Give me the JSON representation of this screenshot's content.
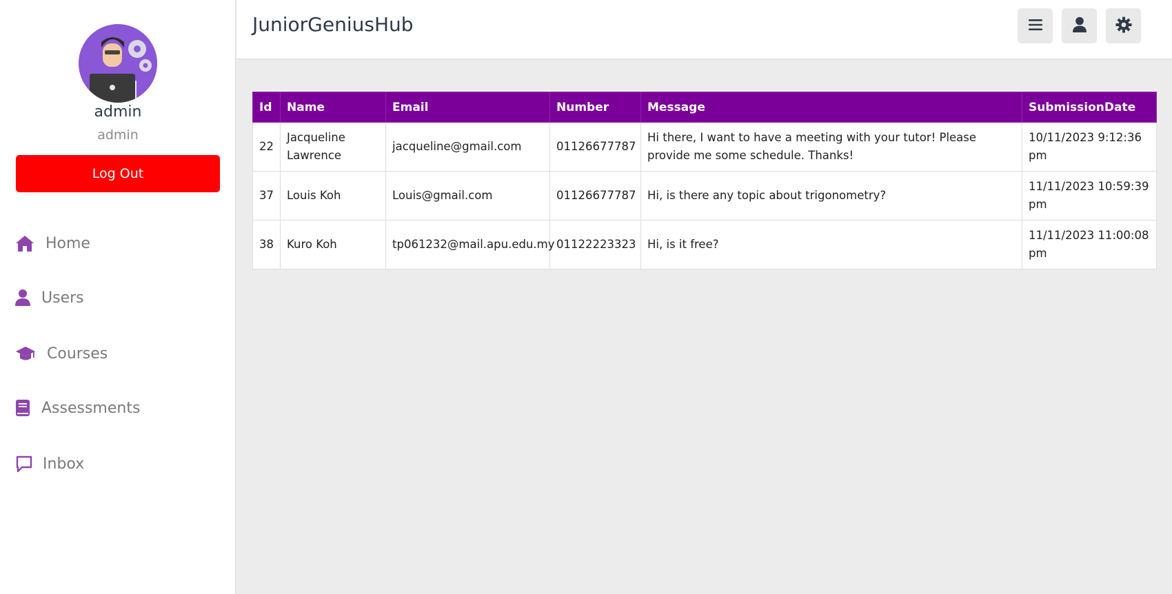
{
  "sidebar": {
    "profile": {
      "name": "admin",
      "role": "admin"
    },
    "logout_label": "Log Out",
    "nav": [
      {
        "label": "Home",
        "icon": "home-icon"
      },
      {
        "label": "Users",
        "icon": "user-icon"
      },
      {
        "label": "Courses",
        "icon": "graduation-cap-icon"
      },
      {
        "label": "Assessments",
        "icon": "book-icon"
      },
      {
        "label": "Inbox",
        "icon": "message-icon"
      }
    ]
  },
  "header": {
    "title": "JuniorGeniusHub",
    "buttons": [
      {
        "icon": "menu-icon"
      },
      {
        "icon": "user-icon"
      },
      {
        "icon": "settings-icon"
      }
    ]
  },
  "table": {
    "columns": [
      "Id",
      "Name",
      "Email",
      "Number",
      "Message",
      "SubmissionDate"
    ],
    "rows": [
      [
        "22",
        "Jacqueline Lawrence",
        "jacqueline@gmail.com",
        "01126677787",
        "Hi there, I want to have a meeting with your tutor! Please provide me some schedule. Thanks!",
        "10/11/2023 9:12:36 pm"
      ],
      [
        "37",
        "Louis Koh",
        "Louis@gmail.com",
        "01126677787",
        "Hi, is there any topic about trigonometry?",
        "11/11/2023 10:59:39 pm"
      ],
      [
        "38",
        "Kuro Koh",
        "tp061232@mail.apu.edu.my",
        "01122223323",
        "Hi, is it free?",
        "11/11/2023 11:00:08 pm"
      ]
    ]
  },
  "colors": {
    "accent": "#7b0099",
    "logout": "#ff0000",
    "nav_icon": "#8e44ad"
  }
}
